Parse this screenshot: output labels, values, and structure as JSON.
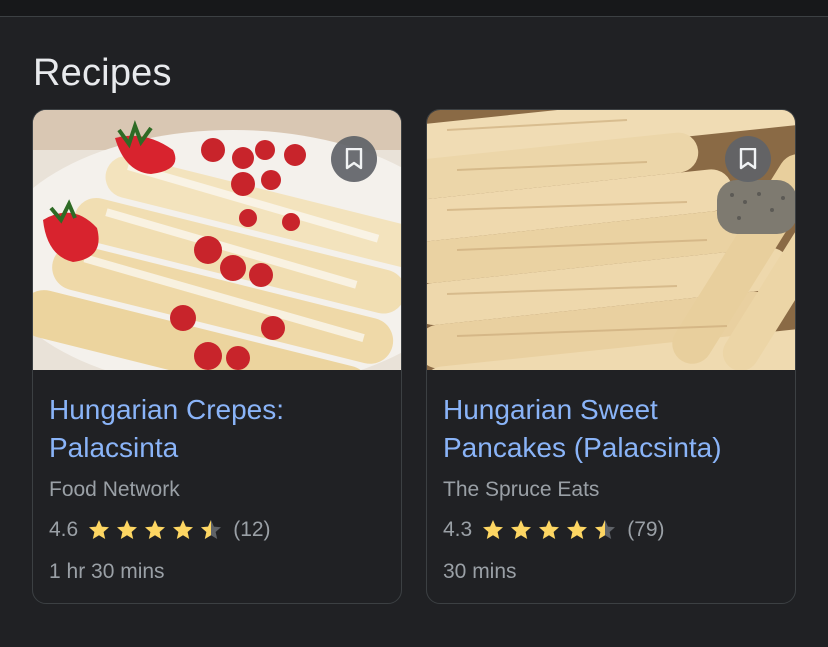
{
  "section": {
    "title": "Recipes"
  },
  "cards": [
    {
      "title": "Hungarian Crepes: Palacsinta",
      "source": "Food Network",
      "rating": "4.6",
      "reviews": "(12)",
      "time": "1 hr 30 mins",
      "image_icon": "crepes-with-raspberries-image",
      "bookmark_icon": "bookmark-icon"
    },
    {
      "title": "Hungarian Sweet Pancakes (Palacsinta)",
      "source": "The Spruce Eats",
      "rating": "4.3",
      "reviews": "(79)",
      "time": "30 mins",
      "image_icon": "rolled-pancakes-image",
      "bookmark_icon": "bookmark-icon"
    }
  ],
  "colors": {
    "background": "#202124",
    "title_link": "#8ab4f8",
    "secondary_text": "#9aa0a6",
    "star": "#fdd663",
    "star_empty": "#5f6368",
    "card_border": "#3c4043"
  }
}
